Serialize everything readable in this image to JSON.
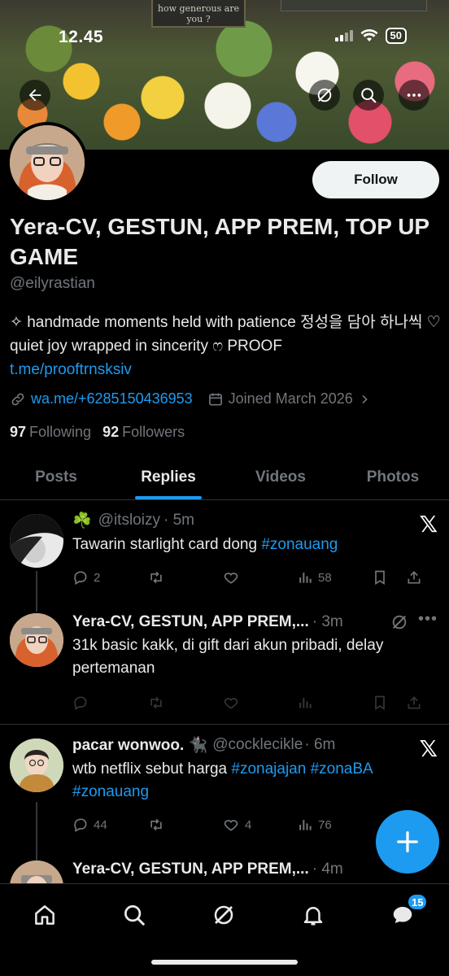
{
  "status_bar": {
    "time": "12.45",
    "battery": "50"
  },
  "banner": {
    "sign_text": "how generous are you ?"
  },
  "profile": {
    "follow_label": "Follow",
    "display_name": "Yera-CV, GESTUN, APP PREM, TOP UP GAME",
    "handle": "@eilyrastian",
    "bio_text": "✧ handmade moments held with patience 정성을 담아 하나씩 ♡ quiet joy wrapped in sincerity ෆ PROOF",
    "bio_link": "t.me/prooftrnsksiv",
    "website": "wa.me/+6285150436953",
    "joined": "Joined March 2026",
    "following_count": "97",
    "following_label": "Following",
    "followers_count": "92",
    "followers_label": "Followers"
  },
  "tabs": [
    {
      "label": "Posts"
    },
    {
      "label": "Replies",
      "active": true
    },
    {
      "label": "Videos"
    },
    {
      "label": "Photos"
    }
  ],
  "posts": [
    {
      "prefix": "☘️",
      "name": "",
      "handle": "@itsloizy",
      "time": "· 5m",
      "text": "Tawarin starlight card dong ",
      "tags": "#zonauang",
      "replies": "2",
      "reposts": "",
      "likes": "",
      "views": "58"
    },
    {
      "name": "Yera-CV, GESTUN, APP PREM,...",
      "time": "· 3m",
      "text": "31k basic kakk, di gift dari akun pribadi, delay pertemanan"
    },
    {
      "name": "pacar wonwoo. 🐈‍⬛",
      "handle": "@cocklecikle",
      "time": "· 6m",
      "text": "wtb netflix sebut harga ",
      "tags": "#zonajajan #zonaBA #zonauang",
      "replies": "44",
      "likes": "4",
      "views": "76"
    },
    {
      "name": "Yera-CV, GESTUN, APP PREM,...",
      "time": "· 4m"
    }
  ],
  "nav": {
    "messages_badge": "15"
  },
  "colors": {
    "accent": "#1d9bf0",
    "background": "#000000",
    "muted": "#71767b"
  }
}
